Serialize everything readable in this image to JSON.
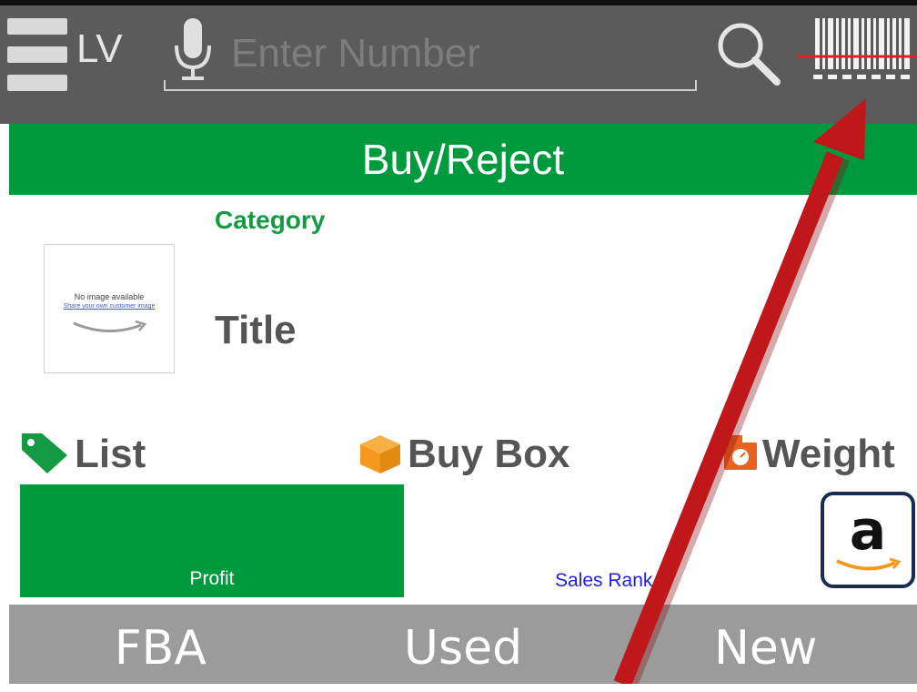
{
  "toolbar": {
    "brand": "LV",
    "search_placeholder": "Enter Number",
    "icons": [
      "menu-icon",
      "microphone-icon",
      "search-icon",
      "barcode-scanner-icon"
    ]
  },
  "header": {
    "title": "Buy/Reject"
  },
  "product": {
    "category": "Category",
    "title": "Title",
    "thumbnail": {
      "line1": "No image available",
      "line2": "Share your own customer image"
    }
  },
  "stats": {
    "list_label": "List",
    "buybox_label": "Buy Box",
    "weight_label": "Weight",
    "icons": [
      "price-tag-icon",
      "box-icon",
      "scale-icon",
      "amazon-icon"
    ]
  },
  "metrics": {
    "profit_label": "Profit",
    "sales_rank_label": "Sales Rank",
    "amazon_button_letter": "a"
  },
  "tabs": [
    "FBA",
    "Used",
    "New"
  ],
  "colors": {
    "toolbar": "#5b5b5b",
    "accent_green": "#009a3e",
    "category_green": "#139a43",
    "tab_bar": "#9b9b9b",
    "sales_rank_blue": "#1f1fe0",
    "annotation_arrow": "#c0171a"
  }
}
